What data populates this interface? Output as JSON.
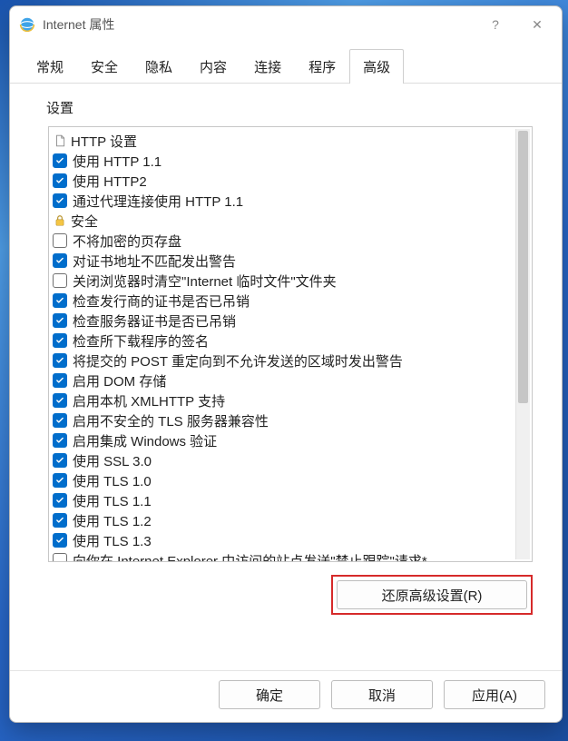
{
  "window": {
    "title": "Internet 属性",
    "help_glyph": "?",
    "close_glyph": "✕"
  },
  "tabs": [
    {
      "label": "常规",
      "active": false
    },
    {
      "label": "安全",
      "active": false
    },
    {
      "label": "隐私",
      "active": false
    },
    {
      "label": "内容",
      "active": false
    },
    {
      "label": "连接",
      "active": false
    },
    {
      "label": "程序",
      "active": false
    },
    {
      "label": "高级",
      "active": true
    }
  ],
  "section_label": "设置",
  "tree": [
    {
      "icon": "page",
      "label": "HTTP 设置",
      "items": [
        {
          "checked": true,
          "label": "使用 HTTP 1.1"
        },
        {
          "checked": true,
          "label": "使用 HTTP2"
        },
        {
          "checked": true,
          "label": "通过代理连接使用 HTTP 1.1"
        }
      ]
    },
    {
      "icon": "lock",
      "label": "安全",
      "items": [
        {
          "checked": false,
          "label": "不将加密的页存盘"
        },
        {
          "checked": true,
          "label": "对证书地址不匹配发出警告"
        },
        {
          "checked": false,
          "label": "关闭浏览器时清空\"Internet 临时文件\"文件夹"
        },
        {
          "checked": true,
          "label": "检查发行商的证书是否已吊销"
        },
        {
          "checked": true,
          "label": "检查服务器证书是否已吊销"
        },
        {
          "checked": true,
          "label": "检查所下载程序的签名"
        },
        {
          "checked": true,
          "label": "将提交的 POST 重定向到不允许发送的区域时发出警告"
        },
        {
          "checked": true,
          "label": "启用 DOM 存储"
        },
        {
          "checked": true,
          "label": "启用本机 XMLHTTP 支持"
        },
        {
          "checked": true,
          "label": "启用不安全的 TLS 服务器兼容性"
        },
        {
          "checked": true,
          "label": "启用集成 Windows 验证"
        },
        {
          "checked": true,
          "label": "使用 SSL 3.0"
        },
        {
          "checked": true,
          "label": "使用 TLS 1.0"
        },
        {
          "checked": true,
          "label": "使用 TLS 1.1"
        },
        {
          "checked": true,
          "label": "使用 TLS 1.2"
        },
        {
          "checked": true,
          "label": "使用 TLS 1.3"
        },
        {
          "checked": false,
          "label": "向你在 Internet Explorer 中访问的站点发送\"禁止跟踪\"请求*"
        }
      ]
    }
  ],
  "restore_button": "还原高级设置(R)",
  "footer": {
    "ok": "确定",
    "cancel": "取消",
    "apply": "应用(A)"
  }
}
